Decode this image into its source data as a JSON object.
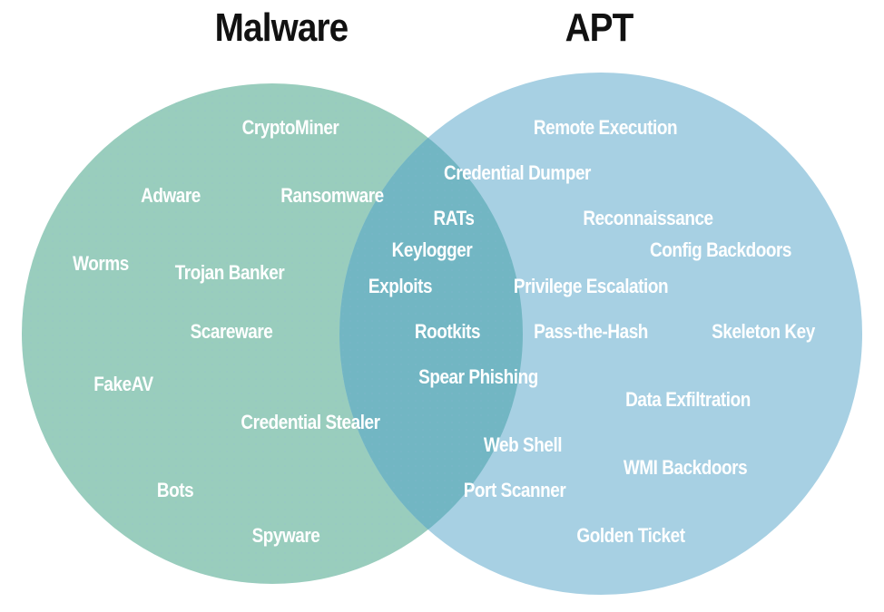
{
  "diagram": {
    "type": "venn",
    "sets": [
      {
        "name": "Malware",
        "color": "#99cdbd"
      },
      {
        "name": "APT",
        "color": "#a7d0e3"
      }
    ],
    "overlap_color": "#72b6c3",
    "text_color": "#ffffff",
    "title_color": "#111111"
  },
  "titles": {
    "left": "Malware",
    "right": "APT"
  },
  "items": {
    "malware_only": [
      "CryptoMiner",
      "Adware",
      "Ransomware",
      "Worms",
      "Trojan Banker",
      "Scareware",
      "FakeAV",
      "Credential Stealer",
      "Bots",
      "Spyware"
    ],
    "both": [
      "Credential Dumper",
      "RATs",
      "Keylogger",
      "Exploits",
      "Rootkits",
      "Spear Phishing",
      "Web Shell",
      "Port Scanner"
    ],
    "apt_only": [
      "Remote Execution",
      "Reconnaissance",
      "Config Backdoors",
      "Privilege Escalation",
      "Pass-the-Hash",
      "Skeleton Key",
      "Data Exfiltration",
      "WMI Backdoors",
      "Golden Ticket"
    ]
  }
}
